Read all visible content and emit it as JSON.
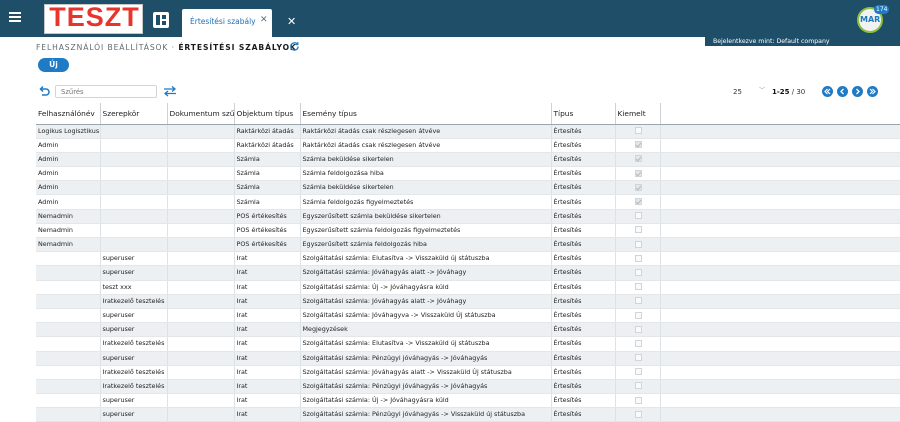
{
  "header": {
    "logo_text": "TESZT",
    "active_tab": "Értesítési szabály",
    "tab_close_icon": "close-icon",
    "close_all_icon": "close-icon",
    "menu_icon": "hamburger-icon",
    "apps_icon": "dashboard-grid-icon",
    "brand_badge": "MAR",
    "notification_count": "174",
    "login_info": "Bejelentkezve mint: Default company",
    "colors": {
      "bar": "#1f4e69",
      "accent": "#1f7bc6",
      "logo_red": "#e7352b"
    }
  },
  "page": {
    "breadcrumb_parent": "FELHASZNÁLÓI BEÁLLÍTÁSOK",
    "breadcrumb_separator": "·",
    "breadcrumb_current": "ÉRTESÍTÉSI SZABÁLYOK",
    "refresh_icon": "refresh-icon",
    "new_button": "Új"
  },
  "toolbar": {
    "filter_placeholder": "Szűrés",
    "reset_icon": "undo-filter-icon",
    "swap_icon": "swap-arrows-icon",
    "page_size": "25",
    "range": "1-25",
    "total": " / 30",
    "nav_icons": [
      "first-page-icon",
      "prev-page-icon",
      "next-page-icon",
      "last-page-icon"
    ]
  },
  "table": {
    "columns": [
      "Felhasználónév",
      "Szerepkör",
      "Dokumentum szűrés",
      "Objektum típus",
      "Esemény típus",
      "Típus",
      "Kiemelt",
      ""
    ],
    "rows": [
      {
        "user": "Logikus Logisztikus",
        "role": "",
        "doc": "",
        "object": "Raktárközi átadás",
        "event": "Raktárközi átadás csak részlegesen átvéve",
        "type": "Értesítés",
        "highlighted": false
      },
      {
        "user": "Admin",
        "role": "",
        "doc": "",
        "object": "Raktárközi átadás",
        "event": "Raktárközi átadás csak részlegesen átvéve",
        "type": "Értesítés",
        "highlighted": true
      },
      {
        "user": "Admin",
        "role": "",
        "doc": "",
        "object": "Számla",
        "event": "Számla beküldése sikertelen",
        "type": "Értesítés",
        "highlighted": true
      },
      {
        "user": "Admin",
        "role": "",
        "doc": "",
        "object": "Számla",
        "event": "Számla feldolgozása hiba",
        "type": "Értesítés",
        "highlighted": true
      },
      {
        "user": "Admin",
        "role": "",
        "doc": "",
        "object": "Számla",
        "event": "Számla beküldése sikertelen",
        "type": "Értesítés",
        "highlighted": true
      },
      {
        "user": "Admin",
        "role": "",
        "doc": "",
        "object": "Számla",
        "event": "Számla feldolgozás figyelmeztetés",
        "type": "Értesítés",
        "highlighted": true
      },
      {
        "user": "Nemadmin",
        "role": "",
        "doc": "",
        "object": "POS értékesítés",
        "event": "Egyszerűsített számla beküldése sikertelen",
        "type": "Értesítés",
        "highlighted": false
      },
      {
        "user": "Nemadmin",
        "role": "",
        "doc": "",
        "object": "POS értékesítés",
        "event": "Egyszerűsített számla feldolgozás figyelmeztetés",
        "type": "Értesítés",
        "highlighted": false
      },
      {
        "user": "Nemadmin",
        "role": "",
        "doc": "",
        "object": "POS értékesítés",
        "event": "Egyszerűsített számla feldolgozás hiba",
        "type": "Értesítés",
        "highlighted": false
      },
      {
        "user": "",
        "role": "superuser",
        "doc": "",
        "object": "Irat",
        "event": "Szolgáltatási számla: Elutasítva -> Visszaküld új státuszba",
        "type": "Értesítés",
        "highlighted": false
      },
      {
        "user": "",
        "role": "superuser",
        "doc": "",
        "object": "Irat",
        "event": "Szolgáltatási számla: Jóváhagyás alatt -> Jóváhagy",
        "type": "Értesítés",
        "highlighted": false
      },
      {
        "user": "",
        "role": "teszt xxx",
        "doc": "",
        "object": "Irat",
        "event": "Szolgáltatási számla: Új -> Jóváhagyásra küld",
        "type": "Értesítés",
        "highlighted": false
      },
      {
        "user": "",
        "role": "Iratkezelő tesztelés",
        "doc": "",
        "object": "Irat",
        "event": "Szolgáltatási számla: Jóváhagyás alatt -> Jóváhagy",
        "type": "Értesítés",
        "highlighted": false
      },
      {
        "user": "",
        "role": "superuser",
        "doc": "",
        "object": "Irat",
        "event": "Szolgáltatási számla: Jóváhagyva -> Visszaküld Új státuszba",
        "type": "Értesítés",
        "highlighted": false
      },
      {
        "user": "",
        "role": "superuser",
        "doc": "",
        "object": "Irat",
        "event": "Megjegyzések",
        "type": "Értesítés",
        "highlighted": false
      },
      {
        "user": "",
        "role": "Iratkezelő tesztelés",
        "doc": "",
        "object": "Irat",
        "event": "Szolgáltatási számla: Elutasítva -> Visszaküld új státuszba",
        "type": "Értesítés",
        "highlighted": false
      },
      {
        "user": "",
        "role": "superuser",
        "doc": "",
        "object": "Irat",
        "event": "Szolgáltatási számla: Pénzügyi jóváhagyás -> Jóváhagyás",
        "type": "Értesítés",
        "highlighted": false
      },
      {
        "user": "",
        "role": "Iratkezelő tesztelés",
        "doc": "",
        "object": "Irat",
        "event": "Szolgáltatási számla: Jóváhagyás alatt -> Visszaküld Új státuszba",
        "type": "Értesítés",
        "highlighted": false
      },
      {
        "user": "",
        "role": "Iratkezelő tesztelés",
        "doc": "",
        "object": "Irat",
        "event": "Szolgáltatási számla: Pénzügyi jóváhagyás -> Jóváhagyás",
        "type": "Értesítés",
        "highlighted": false
      },
      {
        "user": "",
        "role": "superuser",
        "doc": "",
        "object": "Irat",
        "event": "Szolgáltatási számla: Új -> Jóváhagyásra küld",
        "type": "Értesítés",
        "highlighted": false
      },
      {
        "user": "",
        "role": "superuser",
        "doc": "",
        "object": "Irat",
        "event": "Szolgáltatási számla: Pénzügyi jóváhagyás -> Visszaküld új státuszba",
        "type": "Értesítés",
        "highlighted": false
      }
    ]
  }
}
